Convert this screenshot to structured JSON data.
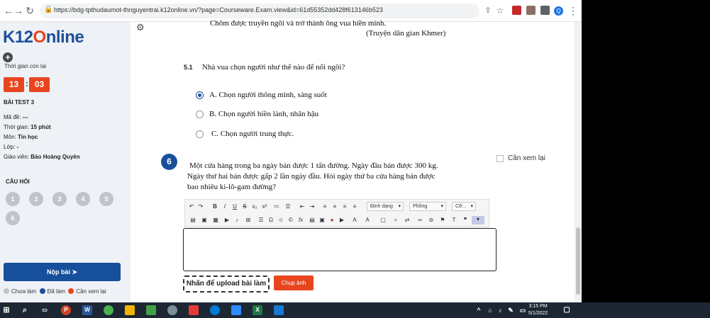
{
  "browser": {
    "url": "https://bdg-tpthudaumot-thnguyentrai.k12online.vn/?page=Courseware.Exam.view&id=61d55352dd428f613146b523",
    "profile_initial": "Q"
  },
  "sidebar": {
    "logo_pre": "K12",
    "logo_o": "O",
    "logo_post": "nline",
    "time_label": "Thời gian còn lại",
    "minutes": "13",
    "seconds": "03",
    "test_title": "BÀI TEST 3",
    "exam_code_label": "Mã đề:",
    "exam_code": "---",
    "duration_label": "Thời gian:",
    "duration": "15 phút",
    "subject_label": "Môn:",
    "subject": "Tin học",
    "class_label": "Lớp:",
    "class_value": "-",
    "teacher_label": "Giáo viên:",
    "teacher": "Bảo Hoàng Quyên",
    "questions_heading": "CÂU HỎI",
    "question_numbers": [
      "1",
      "2",
      "3",
      "4",
      "5",
      "6"
    ],
    "submit_label": "Nộp bài",
    "legend": {
      "not_done": "Chưa làm",
      "done": "Đã làm",
      "review": "Cần xem lại"
    },
    "colors": {
      "done": "#16509c",
      "review": "#e8451e",
      "not_done": "#bfc4ca"
    }
  },
  "main": {
    "poem_line": "Chôm được truyền ngôi và trở thành ông vua hiền minh.",
    "poem_source": "(Truyện dân gian Khmer)",
    "q51_number": "5.1",
    "q51_text": "Nhà vua chọn người như thế nào để nối ngôi?",
    "options": [
      {
        "label": "A. Chọn người thông minh, sáng suốt",
        "selected": true
      },
      {
        "label": "B. Chọn người hiền lành, nhân hậu",
        "selected": false
      },
      {
        "label": "C. Chọn người trung thực.",
        "selected": false
      }
    ],
    "q6_number": "6",
    "q6_lines": [
      "Một cửa hàng trong ba ngày bán được 1 tấn đường. Ngày đầu bán được 300 kg.",
      "Ngày thứ hai bán được gấp 2 lần ngày đầu. Hỏi ngày thứ ba cửa hàng bán được",
      "bao nhiêu ki-lô-gam đường?"
    ],
    "review_label": "Cần xem lại",
    "toolbar": {
      "format_label": "Định dạng",
      "font_label": "Phông",
      "size_label": "Cỡ..."
    },
    "upload_label": "Nhấn để upload bài làm",
    "photo_label": "Chụp ảnh"
  },
  "taskbar": {
    "time": "3:15 PM",
    "date": "5/1/2022"
  }
}
